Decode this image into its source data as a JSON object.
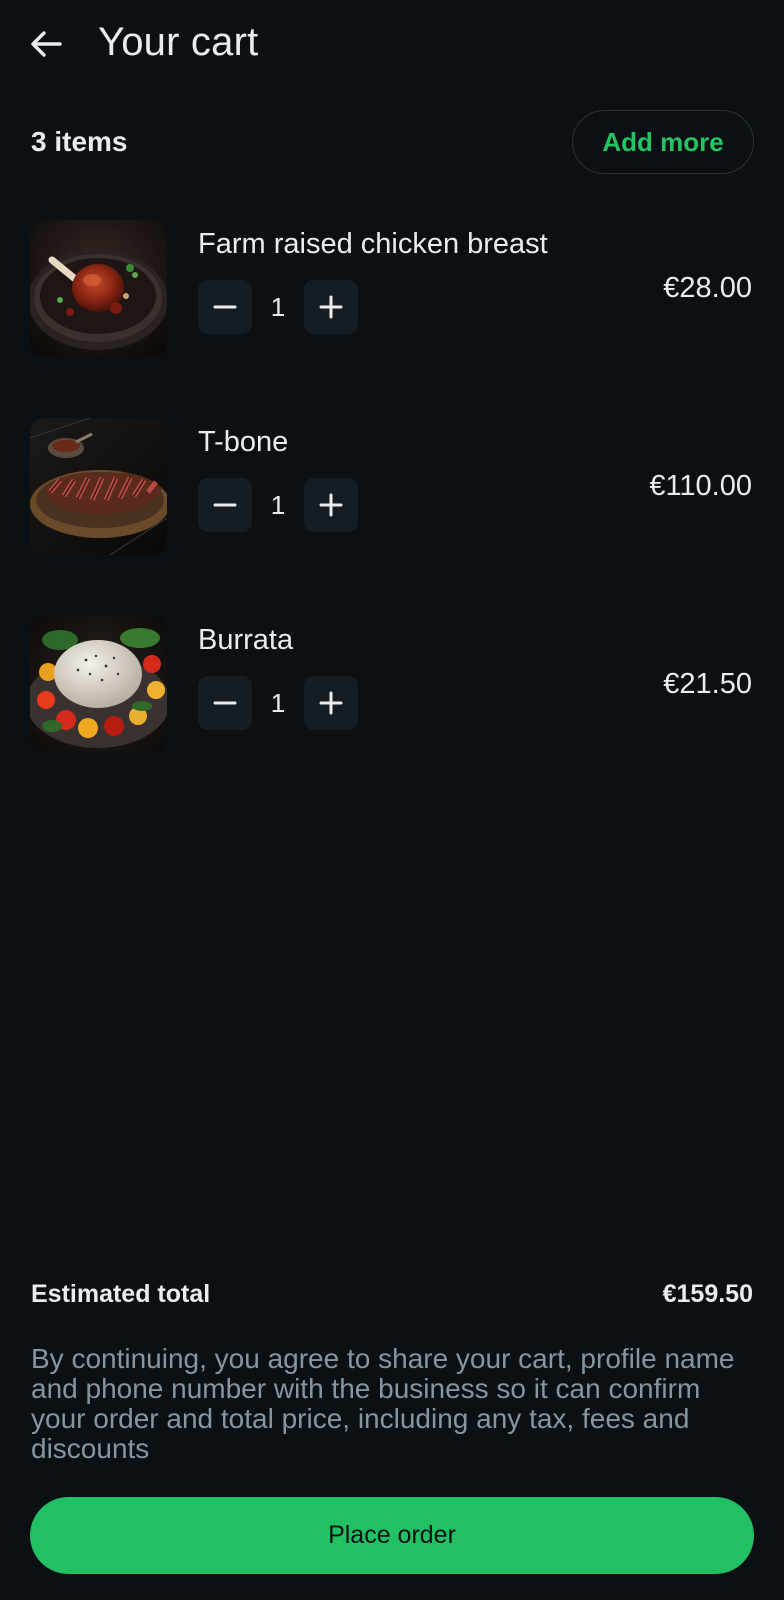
{
  "header": {
    "back_icon": "arrow-left-icon",
    "title": "Your cart"
  },
  "cart": {
    "item_count_label": "3 items",
    "add_more_label": "Add more",
    "items": [
      {
        "name": "Farm raised chicken breast",
        "quantity": "1",
        "price": "€28.00",
        "image": "chicken-dish-image"
      },
      {
        "name": "T-bone",
        "quantity": "1",
        "price": "€110.00",
        "image": "steak-dish-image"
      },
      {
        "name": "Burrata",
        "quantity": "1",
        "price": "€21.50",
        "image": "burrata-dish-image"
      }
    ]
  },
  "summary": {
    "total_label": "Estimated total",
    "total_value": "€159.50",
    "disclaimer": "By continuing, you agree to share your cart, profile name and phone number with the business so it can confirm your order and total price, including any tax, fees and discounts"
  },
  "actions": {
    "place_order_label": "Place order"
  },
  "colors": {
    "background": "#0b1014",
    "accent": "#21c063",
    "text": "#e9edef",
    "muted_text": "#8696a0",
    "stepper_bg": "#151d22"
  }
}
